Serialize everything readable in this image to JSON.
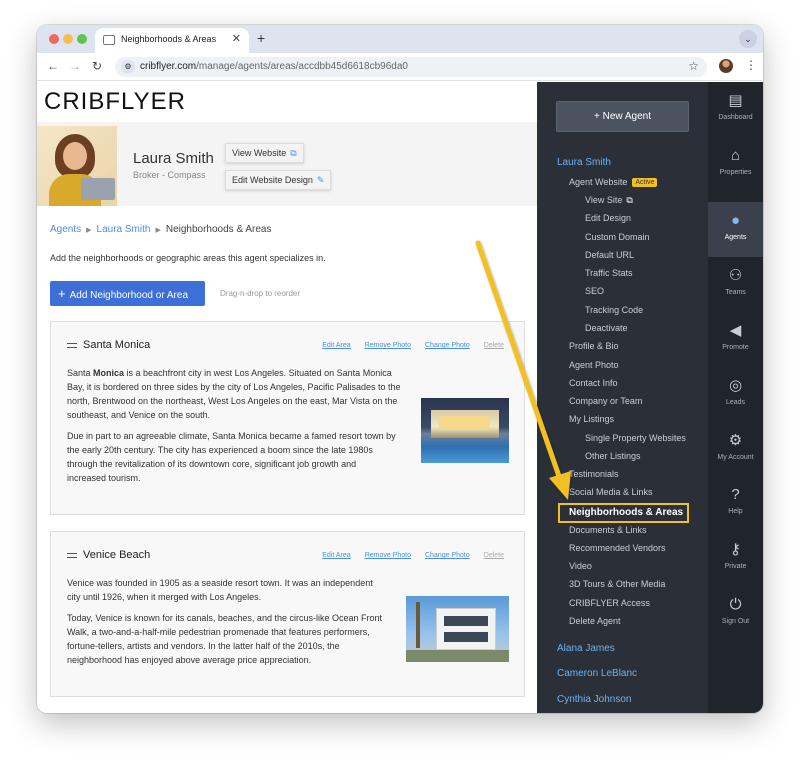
{
  "browser": {
    "tab_title": "Neighborhoods & Areas",
    "tab_close": "✕",
    "tab_new": "+",
    "tab_menu": "⌄",
    "url_domain": "cribflyer.com",
    "url_path": "/manage/agents/areas/accdbb45d6618cb96da0",
    "nav_back": "←",
    "nav_forward": "→",
    "nav_reload": "↻",
    "site_icon": "⚙",
    "star": "☆",
    "menu": "⋮"
  },
  "logo": "CRIBFLYER",
  "agent": {
    "name": "Laura Smith",
    "subtitle": "Broker - Compass",
    "view_website": "View Website",
    "edit_website_design": "Edit Website Design",
    "ext_icon": "⧉",
    "edit_icon": "✎"
  },
  "breadcrumb": {
    "agents": "Agents",
    "agent": "Laura Smith",
    "current": "Neighborhoods & Areas",
    "sep": "▶"
  },
  "intro": "Add the neighborhoods or geographic areas this agent specializes in.",
  "add_button": {
    "plus": "+",
    "label": "Add Neighborhood or Area"
  },
  "drag_hint": "Drag-n-drop to reorder",
  "actions": {
    "edit": "Edit Area",
    "remove_photo": "Remove Photo",
    "change_photo": "Change Photo",
    "delete": "Delete"
  },
  "areas": [
    {
      "title": "Santa Monica",
      "p1a": "Santa ",
      "p1b": "Monica",
      "p1c": " is a beachfront city in west Los Angeles. Situated on Santa Monica",
      "p1_lines": [
        "Bay, it is bordered on three sides by the city of Los Angeles, Pacific Palisades to the",
        "north, Brentwood on the northeast, West Los Angeles on the east, Mar Vista on the",
        "southeast, and Venice on the south."
      ],
      "p2_lines": [
        "Due in part to an agreeable climate, Santa Monica became a famed resort town by",
        "the early 20th century. The city has experienced a boom since the late 1980s",
        "through the revitalization of its downtown core, significant job growth and",
        "increased tourism."
      ]
    },
    {
      "title": "Venice Beach",
      "p1_lines": [
        "Venice was founded in 1905 as a seaside resort town. It was an independent",
        "city until 1926, when it merged with Los Angeles."
      ],
      "p2_lines": [
        "Today, Venice is known for its canals, beaches, and the circus-like Ocean Front",
        "Walk, a two-and-a-half-mile pedestrian promenade that features performers,",
        "fortune-tellers, artists and vendors. In the latter half of the 2010s, the",
        "neighborhood has enjoyed above average price appreciation."
      ]
    }
  ],
  "sidebar": {
    "new_agent": "+  New Agent",
    "current_agent": "Laura Smith",
    "agent_website": "Agent Website",
    "active_badge": "Active",
    "website_items": [
      "View Site",
      "Edit Design",
      "Custom Domain",
      "Default URL",
      "Traffic Stats",
      "SEO",
      "Tracking Code",
      "Deactivate"
    ],
    "ext_icon": "⧉",
    "items_a": [
      "Profile & Bio",
      "Agent Photo",
      "Contact Info",
      "Company or Team",
      "My Listings"
    ],
    "listings_items": [
      "Single Property Websites",
      "Other Listings"
    ],
    "items_b": [
      "Testimonials",
      "Social Media & Links"
    ],
    "highlighted": "Neighborhoods & Areas",
    "items_c": [
      "Documents & Links",
      "Recommended Vendors",
      "Video",
      "3D Tours & Other Media",
      "CRIBFLYER Access",
      "Delete Agent"
    ],
    "other_agents": [
      "Alana James",
      "Cameron LeBlanc",
      "Cynthia Johnson"
    ]
  },
  "rail": [
    {
      "label": "Dashboard",
      "icon": "▤"
    },
    {
      "label": "Properties",
      "icon": "⌂"
    },
    {
      "label": "Agents",
      "icon": "●"
    },
    {
      "label": "Teams",
      "icon": "⚇"
    },
    {
      "label": "Promote",
      "icon": "◀"
    },
    {
      "label": "Leads",
      "icon": "◎"
    },
    {
      "label": "My Account",
      "icon": "⚙"
    },
    {
      "label": "Help",
      "icon": "?"
    },
    {
      "label": "Private",
      "icon": "⚷"
    },
    {
      "label": "Sign Out",
      "icon": "⏻"
    }
  ],
  "colors": {
    "accent": "#3d6fd6",
    "link": "#4a8ee0",
    "highlight": "#f2c022",
    "sidebar": "#2b3038",
    "rail": "#20252c"
  }
}
